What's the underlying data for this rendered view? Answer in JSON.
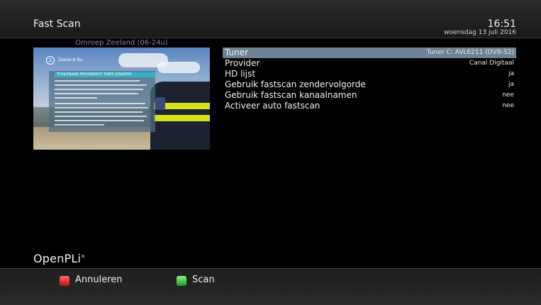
{
  "header": {
    "title": "Fast Scan",
    "time": "16:51",
    "date": "woensdag 13 juli 2016"
  },
  "preview": {
    "channel_name": "Omroep Zeeland (06-24u)",
    "logo_number": "2",
    "station_tag": "Zeeland Nu",
    "teletext_headline": "THOLENAAR MISHANDELT TWEE JONGENS"
  },
  "settings": [
    {
      "label": "Tuner",
      "value": "Tuner C: AVL6211 (DVB-S2)",
      "selected": true
    },
    {
      "label": "Provider",
      "value": "Canal Digitaal",
      "selected": false
    },
    {
      "label": "HD lijst",
      "value": "ja",
      "selected": false
    },
    {
      "label": "Gebruik fastscan zendervolgorde",
      "value": "ja",
      "selected": false
    },
    {
      "label": "Gebruik fastscan kanaalnamen",
      "value": "nee",
      "selected": false
    },
    {
      "label": "Activeer auto fastscan",
      "value": "nee",
      "selected": false
    }
  ],
  "brand": "OpenPLi",
  "brand_mark": "®",
  "footer": {
    "red_label": "Annuleren",
    "green_label": "Scan"
  },
  "colors": {
    "selected_row": "#6d8395",
    "red_key": "#e02020",
    "green_key": "#3cc03c"
  }
}
